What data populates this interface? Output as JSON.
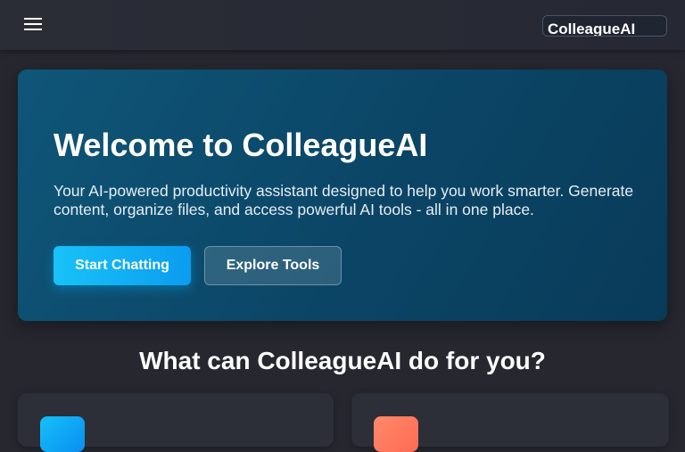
{
  "header": {
    "menu_icon": "hamburger-menu-icon",
    "brand": "ColleagueAI"
  },
  "hero": {
    "title": "Welcome to ColleagueAI",
    "description": "Your AI-powered productivity assistant designed to help you work smarter. Generate content, organize files, and access powerful AI tools - all in one place.",
    "primary_button": "Start Chatting",
    "secondary_button": "Explore Tools"
  },
  "features": {
    "title": "What can ColleagueAI do for you?",
    "cards": [
      {
        "icon_color": "#15c0f8"
      },
      {
        "icon_color": "#ff7a60"
      }
    ]
  },
  "colors": {
    "background": "#26272f",
    "hero": "#0d4d6f",
    "accent": "#18c2f7"
  }
}
